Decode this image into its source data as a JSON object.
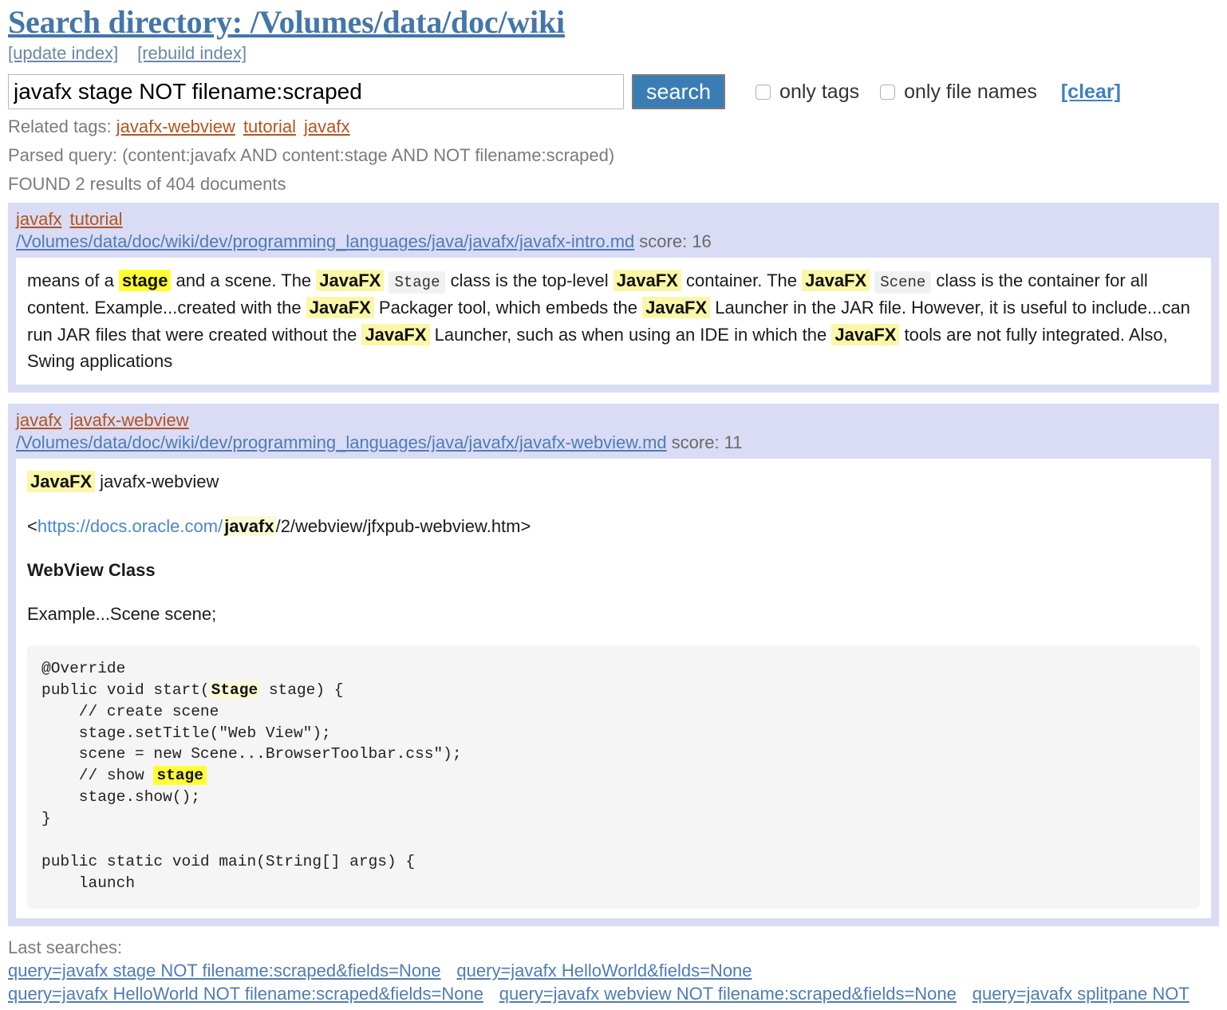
{
  "header": {
    "title": "Search directory: /Volumes/data/doc/wiki",
    "index_links": [
      {
        "label": "[update index]",
        "name": "update-index-link"
      },
      {
        "label": "[rebuild index]",
        "name": "rebuild-index-link"
      }
    ]
  },
  "search": {
    "value": "javafx stage NOT filename:scraped",
    "placeholder": "",
    "button_label": "search",
    "only_tags_label": "only tags",
    "only_tags_checked": false,
    "only_file_names_label": "only file names",
    "only_file_names_checked": false,
    "clear_label": "[clear]"
  },
  "meta": {
    "related_tags_label": "Related tags:",
    "related_tags": [
      "javafx-webview",
      "tutorial",
      "javafx"
    ],
    "parsed_query": "Parsed query: (content:javafx AND content:stage AND NOT filename:scraped)",
    "found": "FOUND 2 results of 404 documents"
  },
  "results": [
    {
      "tags": [
        "javafx",
        "tutorial"
      ],
      "path": "/Volumes/data/doc/wiki/dev/programming_languages/java/javafx/javafx-intro.md",
      "score_label": "score: 16",
      "snippet_parts": [
        {
          "t": "means of a ",
          "s": "plain"
        },
        {
          "t": "stage",
          "s": "hl-strong"
        },
        {
          "t": " and a scene. The ",
          "s": "plain"
        },
        {
          "t": "JavaFX",
          "s": "hl-soft"
        },
        {
          "t": " ",
          "s": "plain"
        },
        {
          "t": "Stage",
          "s": "code"
        },
        {
          "t": " class is the top-level ",
          "s": "plain"
        },
        {
          "t": "JavaFX",
          "s": "hl-soft"
        },
        {
          "t": " container. The ",
          "s": "plain"
        },
        {
          "t": "JavaFX",
          "s": "hl-soft"
        },
        {
          "t": " ",
          "s": "plain"
        },
        {
          "t": "Scene",
          "s": "code"
        },
        {
          "t": " class is the container for all content. Example...created with the ",
          "s": "plain"
        },
        {
          "t": "JavaFX",
          "s": "hl-soft"
        },
        {
          "t": " Packager tool, which embeds the ",
          "s": "plain"
        },
        {
          "t": "JavaFX",
          "s": "hl-soft"
        },
        {
          "t": " Launcher in the JAR file. However, it is useful to include...can run JAR files that were created without the ",
          "s": "plain"
        },
        {
          "t": "JavaFX",
          "s": "hl-soft"
        },
        {
          "t": " Launcher, such as when using an IDE in which the ",
          "s": "plain"
        },
        {
          "t": "JavaFX",
          "s": "hl-soft"
        },
        {
          "t": " tools are not fully integrated. Also, Swing applications",
          "s": "plain"
        }
      ]
    },
    {
      "tags": [
        "javafx",
        "javafx-webview"
      ],
      "path": "/Volumes/data/doc/wiki/dev/programming_languages/java/javafx/javafx-webview.md",
      "score_label": "score: 11",
      "lines": [
        {
          "kind": "para",
          "parts": [
            {
              "t": "JavaFX",
              "s": "hl-soft"
            },
            {
              "t": " javafx-webview",
              "s": "plain"
            }
          ]
        },
        {
          "kind": "para",
          "parts": [
            {
              "t": "<",
              "s": "plain"
            },
            {
              "t": "https://docs.oracle.com/",
              "s": "link"
            },
            {
              "t": "javafx",
              "s": "hl-faint"
            },
            {
              "t": "/2/webview/jfxpub-webview.htm>",
              "s": "plain"
            }
          ]
        },
        {
          "kind": "para",
          "parts": [
            {
              "t": "WebView Class",
              "s": "bold"
            }
          ]
        },
        {
          "kind": "para",
          "parts": [
            {
              "t": "Example...Scene scene;",
              "s": "plain"
            }
          ]
        }
      ],
      "code_parts": [
        {
          "t": "@Override\npublic void start(",
          "s": "plain"
        },
        {
          "t": "Stage",
          "s": "hl-faint"
        },
        {
          "t": " stage) {\n    // create scene\n    stage.setTitle(\"Web View\");\n    scene = new Scene...BrowserToolbar.css\");\n    // show ",
          "s": "plain"
        },
        {
          "t": "stage",
          "s": "hl-strong"
        },
        {
          "t": "\n    stage.show();\n}\n\npublic static void main(String[] args) {\n    launch",
          "s": "plain"
        }
      ]
    }
  ],
  "footer": {
    "label": "Last searches:",
    "links": [
      "query=javafx stage NOT filename:scraped&fields=None",
      "query=javafx HelloWorld&fields=None",
      "query=javafx HelloWorld NOT filename:scraped&fields=None",
      "query=javafx webview NOT filename:scraped&fields=None",
      "query=javafx splitpane NOT"
    ]
  },
  "colors": {
    "title": "#4476a8",
    "tag": "#b5531e",
    "link": "#4e7cb5",
    "result_bg": "#d9dcf4",
    "button": "#3a7db5",
    "highlight_strong": "#ffff33",
    "highlight_soft": "#fbf7a8"
  }
}
